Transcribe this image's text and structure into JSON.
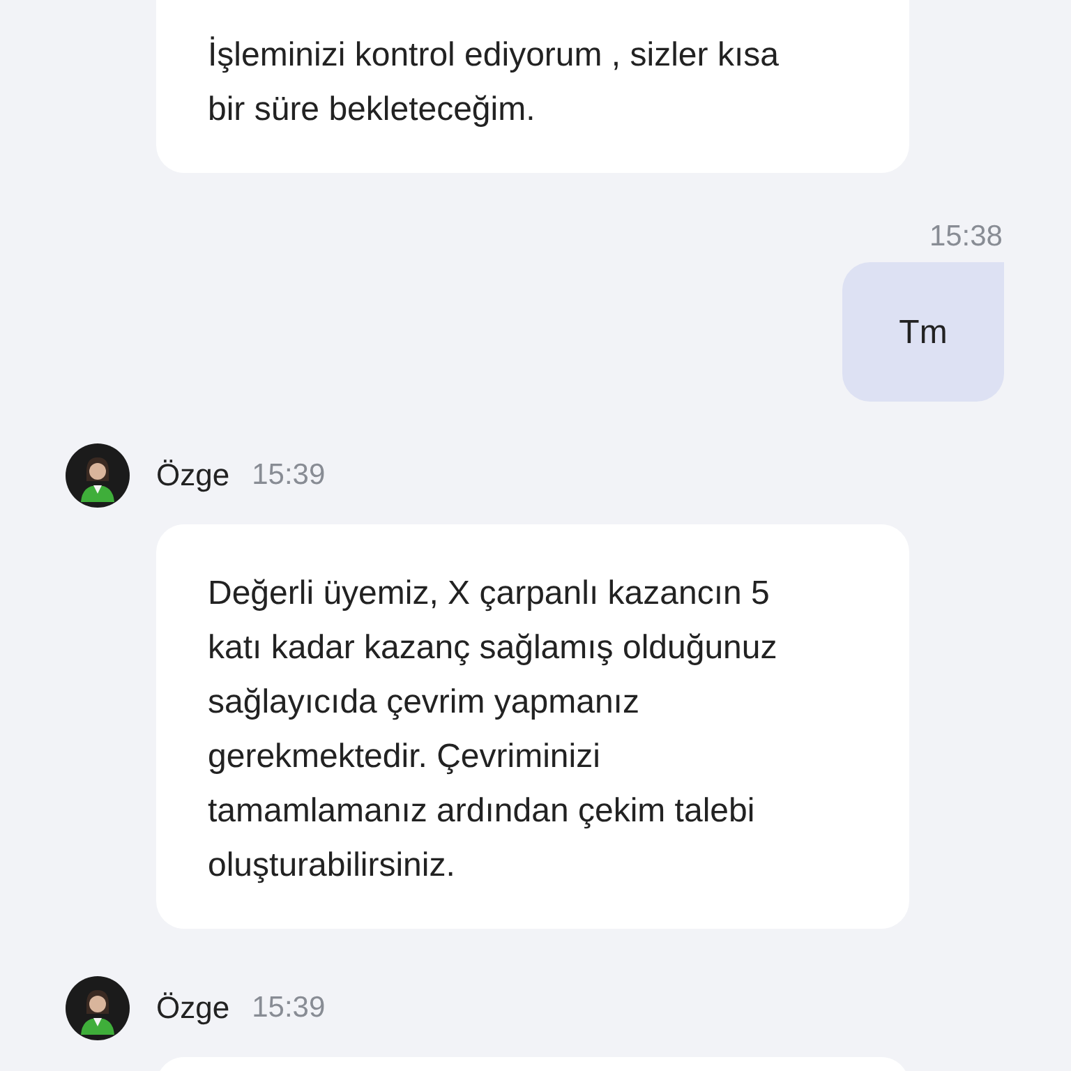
{
  "messages": [
    {
      "kind": "agent",
      "text": "İşleminizi kontrol ediyorum , sizler kısa\nbir süre bekleteceğim."
    },
    {
      "kind": "user",
      "time": "15:38",
      "text": "Tm"
    },
    {
      "kind": "agent",
      "sender": "Özge",
      "time": "15:39",
      "text": "Değerli üyemiz, X çarpanlı kazancın 5\nkatı kadar kazanç sağlamış olduğunuz\nsağlayıcıda çevrim yapmanız\ngerekmektedir. Çevriminizi\ntamamlamanız ardından çekim talebi\noluşturabilirsiniz."
    },
    {
      "kind": "agent",
      "sender": "Özge",
      "time": "15:39"
    }
  ]
}
